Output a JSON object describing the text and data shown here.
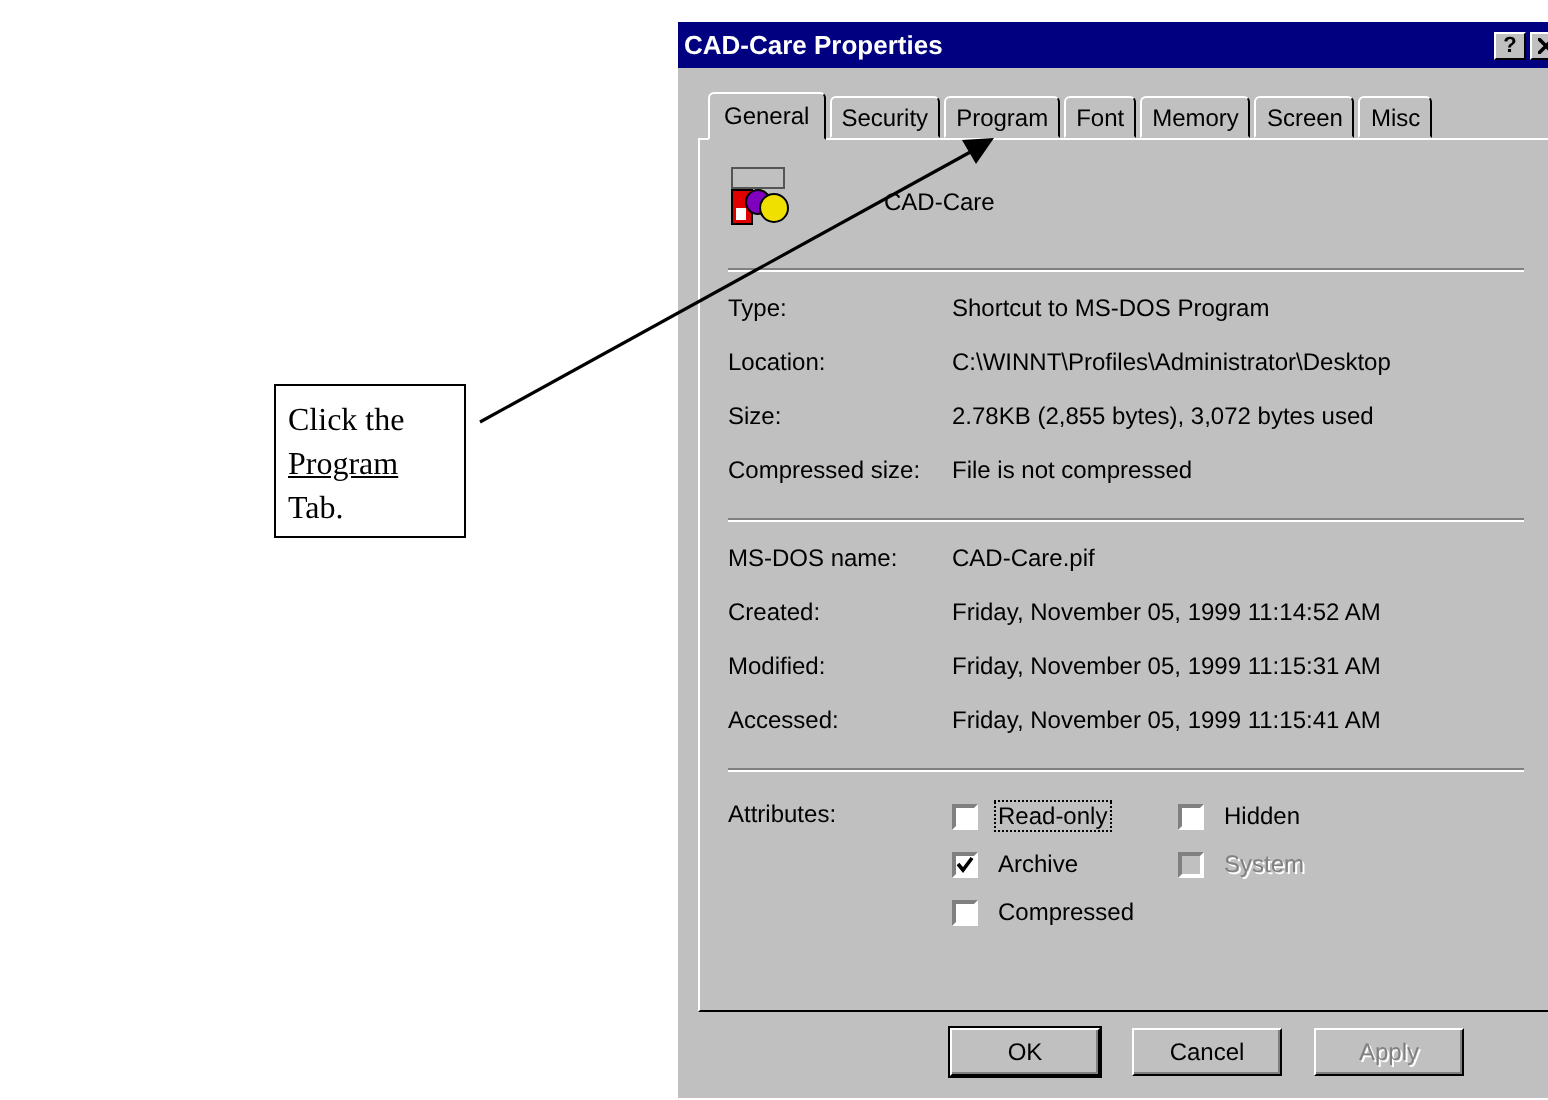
{
  "callout": {
    "before": "Click the ",
    "link": "Program",
    "after": " Tab."
  },
  "window": {
    "title": "CAD-Care Properties",
    "help_button": "?"
  },
  "tabs": [
    {
      "label": "General",
      "selected": true
    },
    {
      "label": "Security",
      "selected": false
    },
    {
      "label": "Program",
      "selected": false
    },
    {
      "label": "Font",
      "selected": false
    },
    {
      "label": "Memory",
      "selected": false
    },
    {
      "label": "Screen",
      "selected": false
    },
    {
      "label": "Misc",
      "selected": false
    }
  ],
  "file": {
    "name": "CAD-Care"
  },
  "details": [
    {
      "label": "Type:",
      "value": "Shortcut to MS-DOS Program"
    },
    {
      "label": "Location:",
      "value": "C:\\WINNT\\Profiles\\Administrator\\Desktop"
    },
    {
      "label": "Size:",
      "value": "2.78KB (2,855 bytes), 3,072 bytes used"
    },
    {
      "label": "Compressed size:",
      "value": "File is not compressed"
    }
  ],
  "dates": [
    {
      "label": "MS-DOS name:",
      "value": "CAD-Care.pif"
    },
    {
      "label": "Created:",
      "value": "Friday, November 05, 1999 11:14:52 AM"
    },
    {
      "label": "Modified:",
      "value": "Friday, November 05, 1999 11:15:31 AM"
    },
    {
      "label": "Accessed:",
      "value": "Friday, November 05, 1999 11:15:41 AM"
    }
  ],
  "attributes": {
    "label": "Attributes:",
    "checkboxes": [
      {
        "label": "Read-only",
        "checked": false,
        "disabled": false,
        "focused": true
      },
      {
        "label": "Hidden",
        "checked": false,
        "disabled": false,
        "focused": false
      },
      {
        "label": "Archive",
        "checked": true,
        "disabled": false,
        "focused": false
      },
      {
        "label": "System",
        "checked": false,
        "disabled": true,
        "focused": false
      },
      {
        "label": "Compressed",
        "checked": false,
        "disabled": false,
        "focused": false
      }
    ]
  },
  "buttons": [
    {
      "label": "OK",
      "default": true,
      "disabled": false
    },
    {
      "label": "Cancel",
      "default": false,
      "disabled": false
    },
    {
      "label": "Apply",
      "default": false,
      "disabled": true
    }
  ]
}
